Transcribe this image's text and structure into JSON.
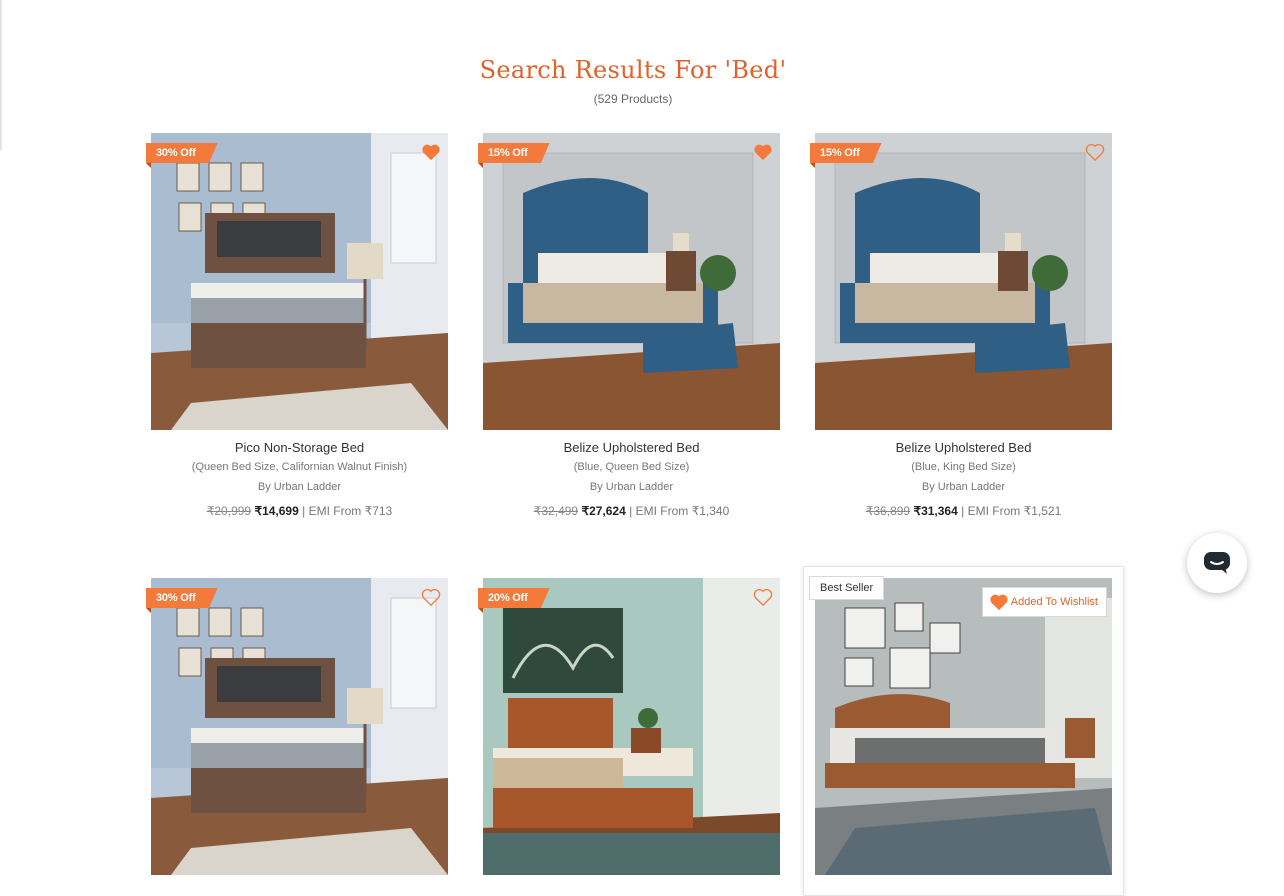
{
  "heading": {
    "title": "Search Results For 'Bed'",
    "count": "(529 Products)"
  },
  "colors": {
    "accent": "#e0622a",
    "badge": "#f47a3b"
  },
  "products": [
    {
      "badge": "30% Off",
      "wishlisted": true,
      "title": "Pico Non-Storage Bed",
      "variant": "(Queen Bed Size, Californian Walnut Finish)",
      "brand": "By Urban Ladder",
      "mrp": "₹20,999",
      "price": "₹14,699",
      "emi": "| EMI From ₹713"
    },
    {
      "badge": "15% Off",
      "wishlisted": true,
      "title": "Belize Upholstered Bed",
      "variant": "(Blue, Queen Bed Size)",
      "brand": "By Urban Ladder",
      "mrp": "₹32,499",
      "price": "₹27,624",
      "emi": "| EMI From ₹1,340"
    },
    {
      "badge": "15% Off",
      "wishlisted": false,
      "title": "Belize Upholstered Bed",
      "variant": "(Blue, King Bed Size)",
      "brand": "By Urban Ladder",
      "mrp": "₹36,899",
      "price": "₹31,364",
      "emi": "| EMI From ₹1,521"
    },
    {
      "badge": "30% Off",
      "wishlisted": false
    },
    {
      "badge": "20% Off",
      "wishlisted": false
    },
    {
      "badge": "Best Seller",
      "wishlisted": true,
      "wishlist_label": "Added To Wishlist"
    }
  ],
  "icons": {
    "wishlist": "heart-icon",
    "chat": "chat-icon"
  }
}
